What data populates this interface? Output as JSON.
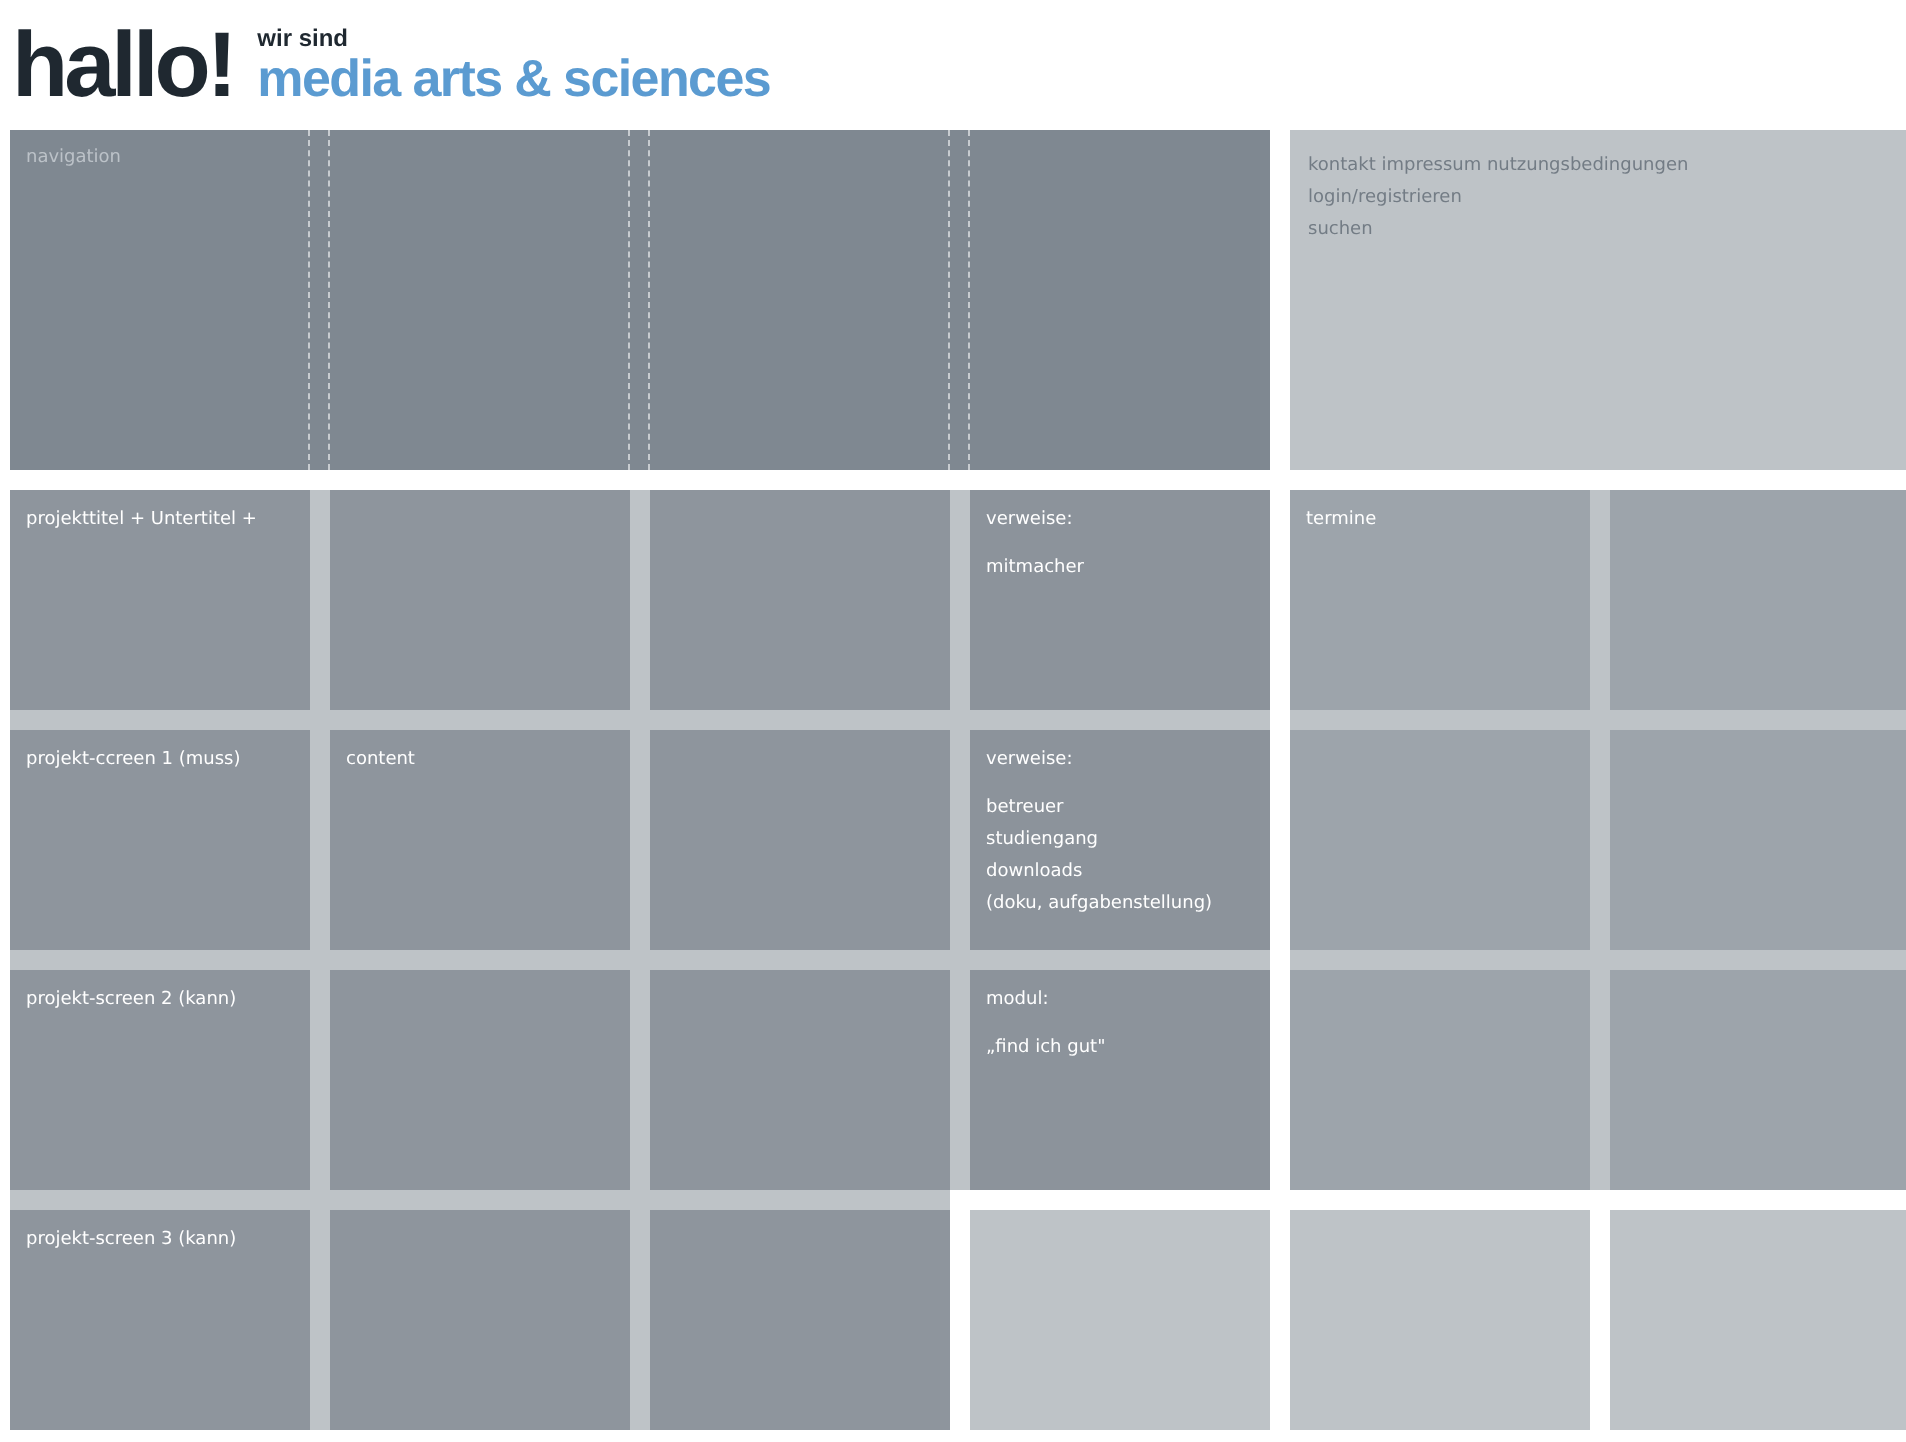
{
  "header": {
    "greeting": "hallo!",
    "tagline": "wir sind",
    "title": "media arts & sciences"
  },
  "navigation": {
    "label": "navigation"
  },
  "service_links": [
    "kontakt impressum nutzungsbedingungen",
    "login/registrieren",
    "suchen"
  ],
  "grid": [
    {
      "kind": "project",
      "heading": "projekttitel + Untertitel +"
    },
    {
      "kind": "project"
    },
    {
      "kind": "project"
    },
    {
      "kind": "reference",
      "heading": "verweise:",
      "items": [
        "mitmacher"
      ]
    },
    {
      "kind": "event",
      "heading": "termine"
    },
    {
      "kind": "event"
    },
    {
      "kind": "project",
      "heading": "projekt-ccreen 1 (muss)"
    },
    {
      "kind": "project",
      "heading": "content"
    },
    {
      "kind": "project"
    },
    {
      "kind": "reference",
      "heading": "verweise:",
      "items": [
        "betreuer",
        "studiengang",
        "downloads",
        "(doku, aufgabenstellung)"
      ]
    },
    {
      "kind": "event"
    },
    {
      "kind": "event"
    },
    {
      "kind": "project",
      "heading": "projekt-screen 2 (kann)"
    },
    {
      "kind": "project"
    },
    {
      "kind": "project"
    },
    {
      "kind": "reference",
      "heading": "modul:",
      "items": [
        "„find ich gut\""
      ]
    },
    {
      "kind": "event"
    },
    {
      "kind": "event"
    },
    {
      "kind": "project",
      "heading": "projekt-screen 3 (kann)"
    },
    {
      "kind": "project"
    },
    {
      "kind": "project"
    },
    {
      "kind": "empty"
    },
    {
      "kind": "empty"
    },
    {
      "kind": "empty"
    }
  ]
}
